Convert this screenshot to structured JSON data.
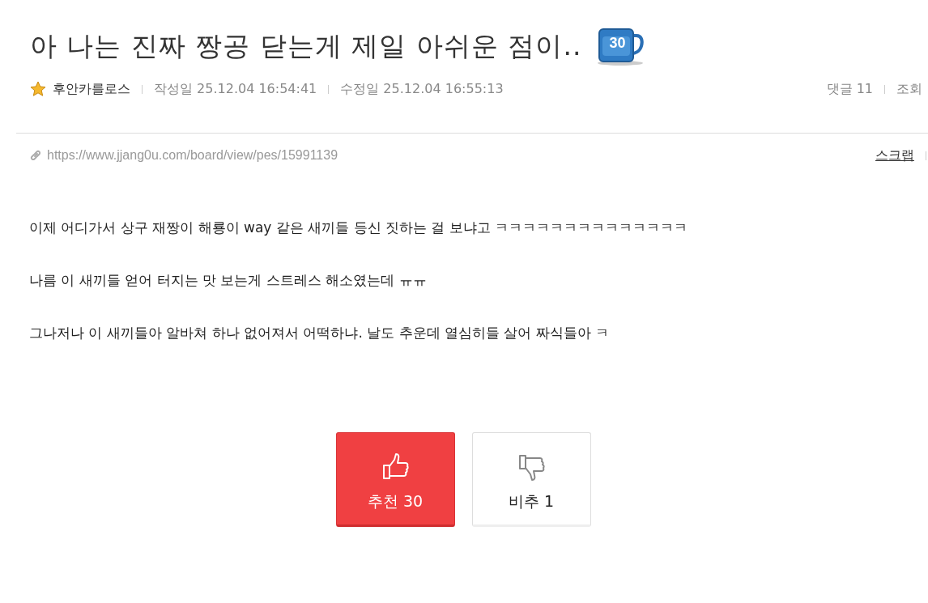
{
  "post": {
    "title": "아 나는 진짜 짱공 닫는게 제일 아쉬운 점이..",
    "title_badge": "30",
    "author": "후안카를로스",
    "written": "작성일 25.12.04 16:54:41",
    "edited": "수정일 25.12.04 16:55:13",
    "comments": "댓글 11",
    "views": "조회",
    "url": "https://www.jjang0u.com/board/view/pes/15991139",
    "scrap": "스크랩",
    "paragraphs": [
      "이제 어디가서 상구 재짱이 해룡이 way 같은 새끼들 등신 짓하는 걸 보냐고 ㅋㅋㅋㅋㅋㅋㅋㅋㅋㅋㅋㅋㅋㅋ",
      "나름 이 새끼들 얻어 터지는 맛 보는게 스트레스 해소였는데 ㅠㅠ",
      "그나저나 이 새끼들아 알바쳐 하나 없어져서 어떡하냐. 날도 추운데 열심히들 살어 짜식들아 ㅋ"
    ]
  },
  "votes": [
    {
      "kind": "up",
      "label": "추천 30",
      "selected": true
    },
    {
      "kind": "down",
      "label": "비추 1",
      "selected": false
    }
  ]
}
